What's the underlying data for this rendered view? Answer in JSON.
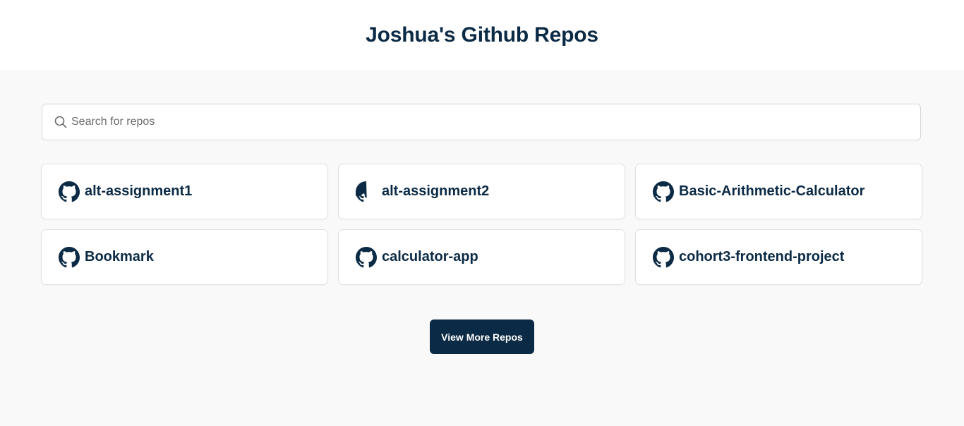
{
  "header": {
    "title": "Joshua's Github Repos"
  },
  "search": {
    "placeholder": "Search for repos",
    "value": "",
    "icon": "search-icon"
  },
  "repos": [
    {
      "name": "alt-assignment1",
      "icon": "github-icon"
    },
    {
      "name": "alt-assignment2",
      "icon": "github-icon"
    },
    {
      "name": "Basic-Arithmetic-Calculator",
      "icon": "github-icon"
    },
    {
      "name": "Bookmark",
      "icon": "github-icon"
    },
    {
      "name": "calculator-app",
      "icon": "github-icon"
    },
    {
      "name": "cohort3-frontend-project",
      "icon": "github-icon"
    }
  ],
  "view_more": {
    "label": "View More Repos"
  },
  "colors": {
    "primary": "#0b2a45",
    "background": "#f9f9f9",
    "card": "#ffffff"
  }
}
